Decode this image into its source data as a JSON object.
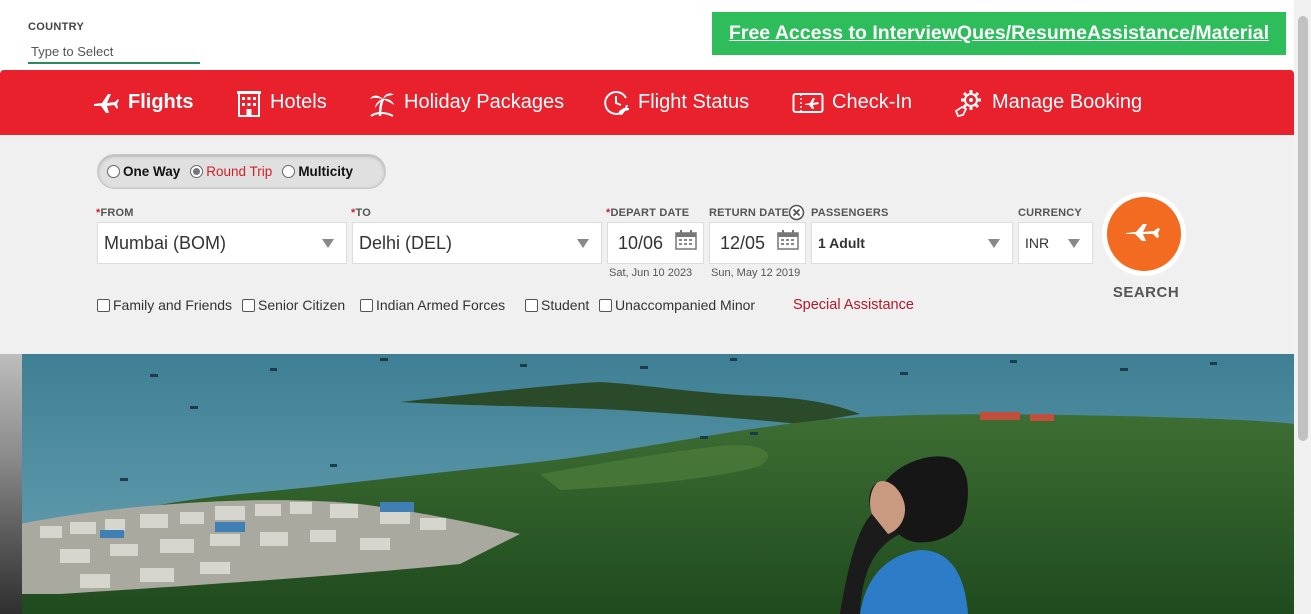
{
  "header": {
    "country_label": "COUNTRY",
    "country_placeholder": "Type to Select",
    "promo_link": "Free Access to InterviewQues/ResumeAssistance/Material"
  },
  "nav": {
    "items": [
      {
        "label": "Flights",
        "icon": "airplane-icon",
        "active": true
      },
      {
        "label": "Hotels",
        "icon": "hotel-icon",
        "active": false
      },
      {
        "label": "Holiday Packages",
        "icon": "palm-tree-icon",
        "active": false
      },
      {
        "label": "Flight Status",
        "icon": "clock-plane-icon",
        "active": false
      },
      {
        "label": "Check-In",
        "icon": "ticket-icon",
        "active": false
      },
      {
        "label": "Manage Booking",
        "icon": "gear-icon",
        "active": false
      }
    ]
  },
  "trip_type": {
    "options": [
      "One Way",
      "Round Trip",
      "Multicity"
    ],
    "selected": "Round Trip"
  },
  "form": {
    "from_label": "FROM",
    "from_value": "Mumbai (BOM)",
    "to_label": "TO",
    "to_value": "Delhi (DEL)",
    "depart_label": "DEPART DATE",
    "depart_value": "10/06",
    "depart_sub": "Sat, Jun 10 2023",
    "return_label": "RETURN DATE",
    "return_value": "12/05",
    "return_sub": "Sun, May 12 2019",
    "passengers_label": "PASSENGERS",
    "passengers_value": "1 Adult",
    "currency_label": "CURRENCY",
    "currency_value": "INR",
    "search_label": "SEARCH",
    "required_mark": "*"
  },
  "checkboxes": [
    "Family and Friends",
    "Senior Citizen",
    "Indian Armed Forces",
    "Student",
    "Unaccompanied Minor"
  ],
  "special_assistance": "Special Assistance",
  "colors": {
    "brand_red": "#e8212d",
    "search_orange": "#f26b21",
    "promo_green": "#2dbd5a"
  }
}
